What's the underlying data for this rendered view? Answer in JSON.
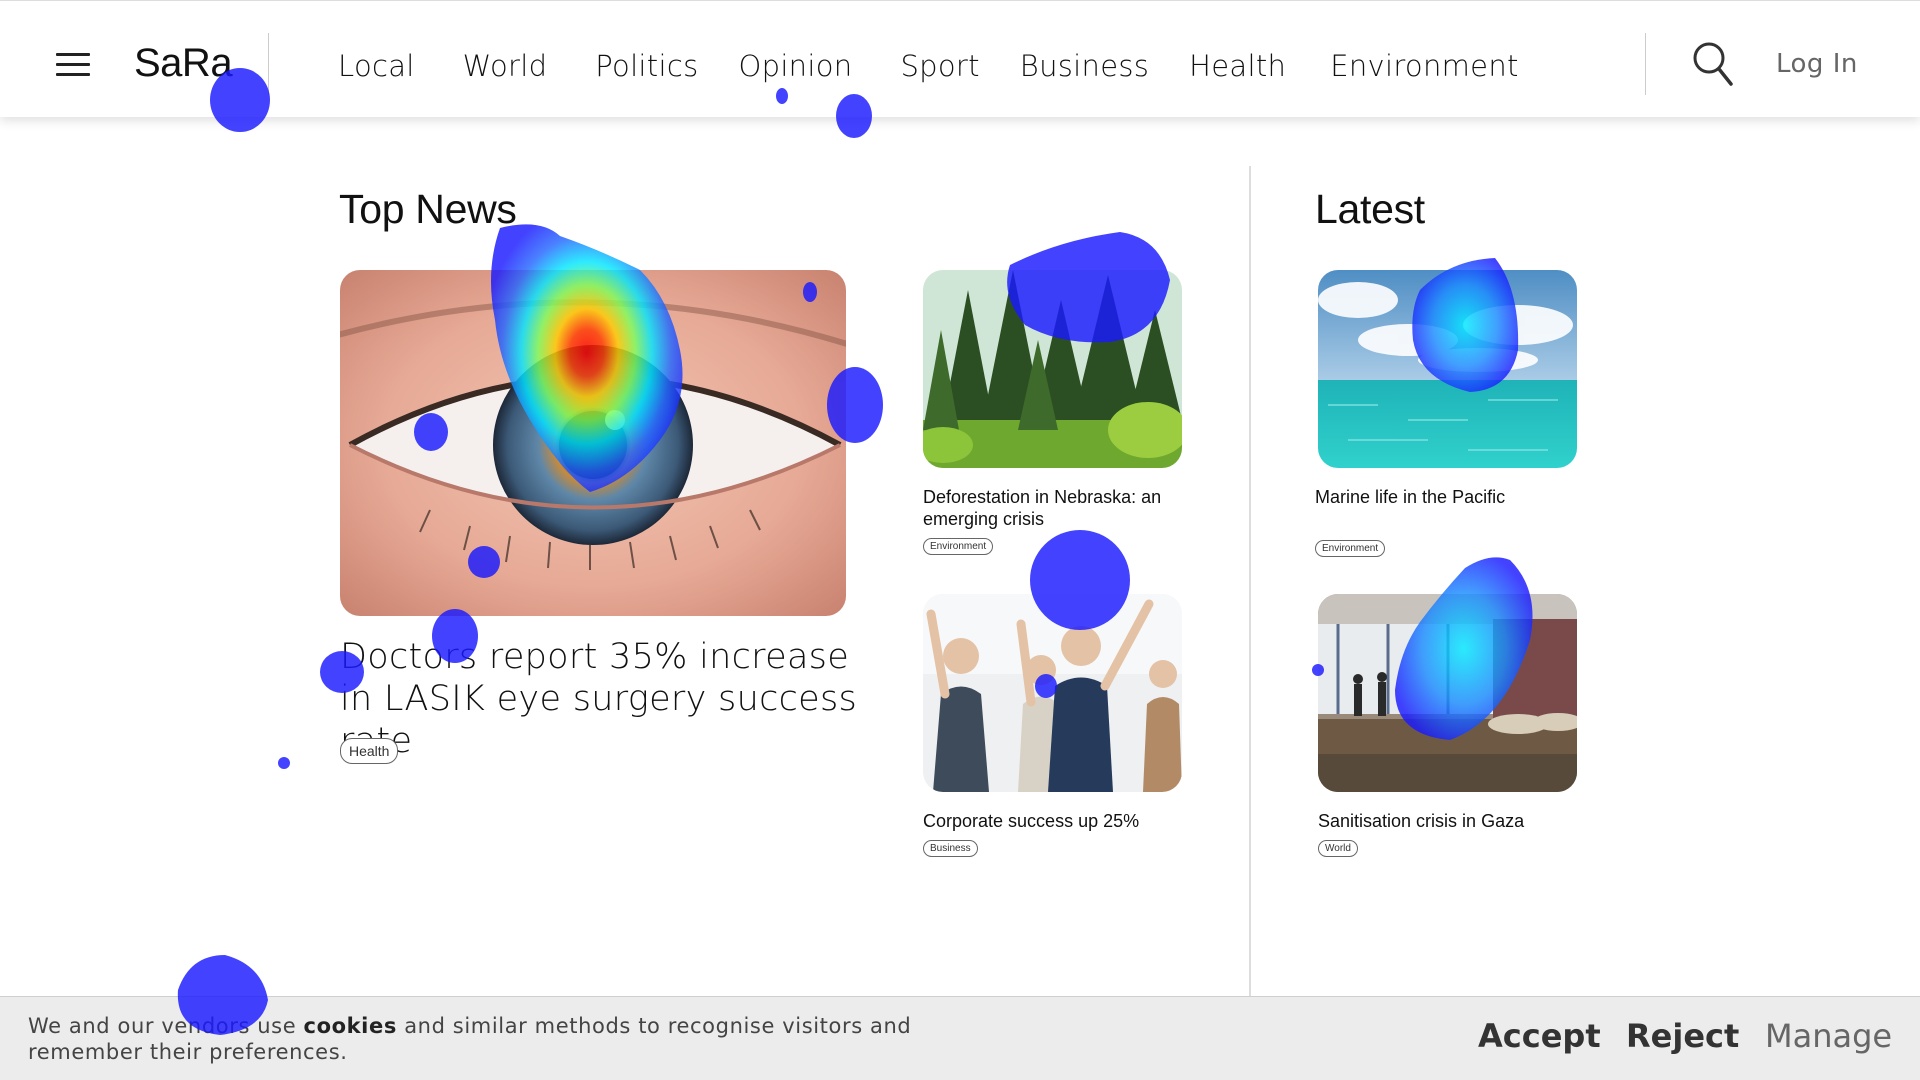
{
  "header": {
    "logo": "SaRa",
    "nav": [
      "Local",
      "World",
      "Politics",
      "Opinion",
      "Sport",
      "Business",
      "Health",
      "Environment"
    ],
    "login": "Log In"
  },
  "top_news": {
    "title": "Top News",
    "main_story": {
      "headline": "Doctors report 35% increase in LASIK eye surgery success rate",
      "tag": "Health",
      "image": "eye-closeup"
    },
    "stories": [
      {
        "headline": "Deforestation in Nebraska: an emerging crisis",
        "tag": "Environment",
        "image": "forest"
      },
      {
        "headline": "Corporate success up 25%",
        "tag": "Business",
        "image": "celebrating-business-people"
      }
    ]
  },
  "latest": {
    "title": "Latest",
    "stories": [
      {
        "headline": "Marine life in the Pacific",
        "tag": "Environment",
        "image": "ocean"
      },
      {
        "headline": "Sanitisation crisis in Gaza",
        "tag": "World",
        "image": "flooded-camp"
      }
    ]
  },
  "cookie_banner": {
    "text_before": "We and our vendors use ",
    "text_bold": "cookies",
    "text_after": " and similar methods to recognise visitors and remember their preferences.",
    "accept": "Accept",
    "reject": "Reject",
    "manage": "Manage"
  },
  "overlay": {
    "type": "attention-heatmap",
    "colors": {
      "low": "#1a1aff",
      "mid": "#00e5ff",
      "high": "#ff0000"
    }
  }
}
